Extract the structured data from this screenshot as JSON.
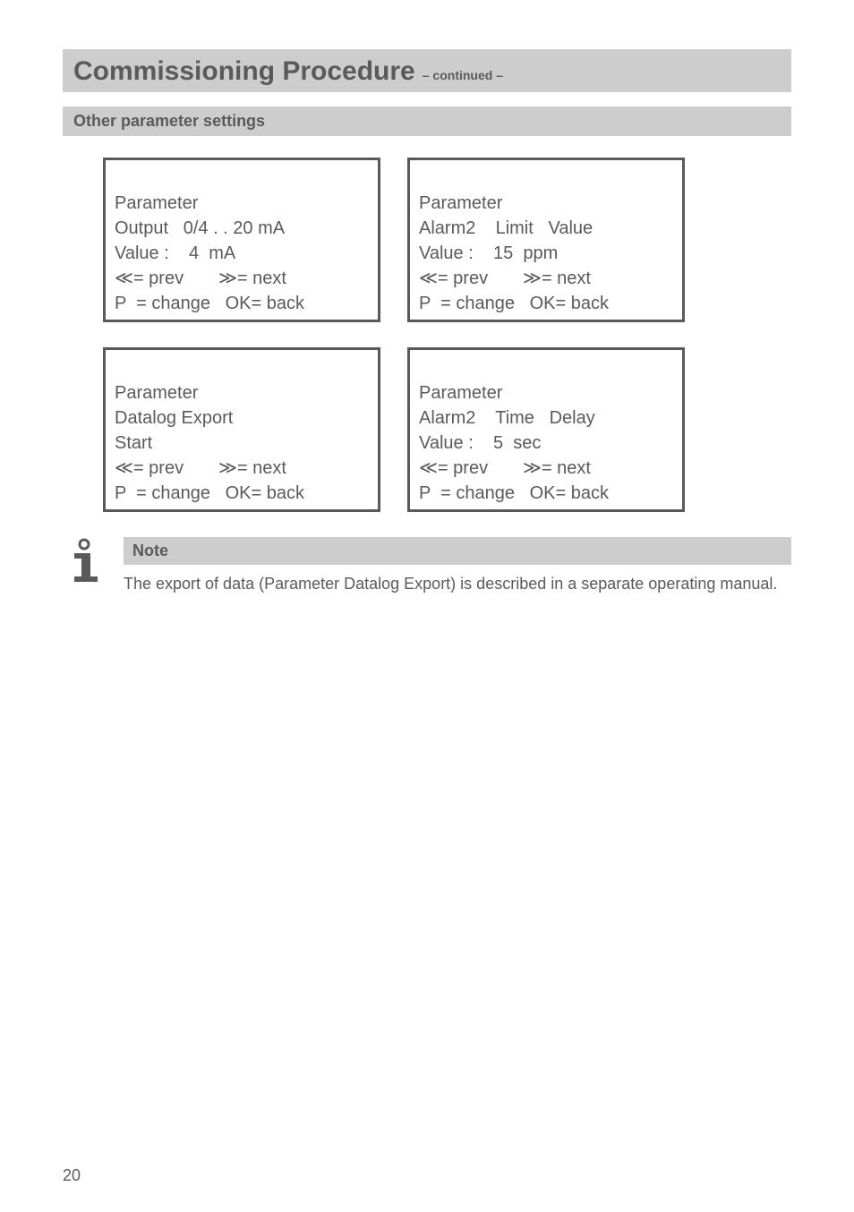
{
  "header": {
    "title": "Commissioning Procedure",
    "subtitle": "– continued –"
  },
  "section": {
    "heading": "Other parameter settings"
  },
  "screens": {
    "top_left": {
      "l1": "Parameter",
      "l2": "Output   0/4 . . 20 mA",
      "l3": "Value :    4  mA",
      "nav_prev": "= prev",
      "nav_next": "= next",
      "nav_p": "P  = change",
      "nav_ok": "OK= back"
    },
    "top_right": {
      "l1": "Parameter",
      "l2": "Alarm2    Limit   Value",
      "l3": "Value :    15  ppm",
      "nav_prev": "= prev",
      "nav_next": "= next",
      "nav_p": "P  = change",
      "nav_ok": "OK= back"
    },
    "bottom_left": {
      "l1": "Parameter",
      "l2": "Datalog Export",
      "l3": "Start",
      "nav_prev": "= prev",
      "nav_next": "= next",
      "nav_p": "P  = change",
      "nav_ok": "OK= back"
    },
    "bottom_right": {
      "l1": "Parameter",
      "l2": "Alarm2    Time   Delay",
      "l3": "Value :    5  sec",
      "nav_prev": "= prev",
      "nav_next": "= next",
      "nav_p": "P  = change",
      "nav_ok": "OK= back"
    }
  },
  "note": {
    "label": "Note",
    "text": "The export of data (Parameter Datalog Export) is described in a separate operating manual."
  },
  "glyphs": {
    "ll": "≪",
    "gg": "≫"
  },
  "page_number": "20"
}
